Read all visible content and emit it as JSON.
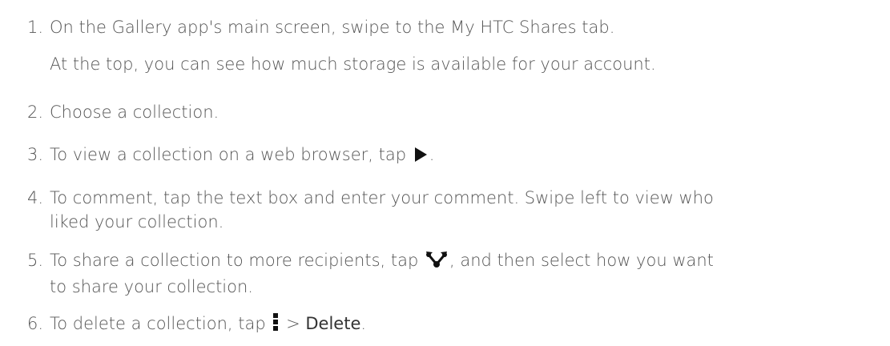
{
  "steps": [
    {
      "number": "1.",
      "text": "On the Gallery app's main screen, swipe to the My HTC Shares tab.",
      "subtext": "At the top, you can see how much storage is available for your account."
    },
    {
      "number": "2.",
      "text": "Choose a collection."
    },
    {
      "number": "3.",
      "text_before": "To view a collection on a web browser, tap",
      "text_after": ".",
      "icon": "play-icon"
    },
    {
      "number": "4.",
      "line1": "To comment, tap the text box and enter your comment. Swipe left to view who",
      "line2": "liked your collection."
    },
    {
      "number": "5.",
      "line1_before": "To share a collection to more recipients, tap",
      "line1_after": ", and then select how you want",
      "line2": "to share your collection.",
      "icon": "share-icon"
    },
    {
      "number": "6.",
      "text_before": "To delete a collection, tap",
      "separator": ">",
      "menu_item": "Delete",
      "text_after": ".",
      "icon": "more-icon"
    }
  ]
}
